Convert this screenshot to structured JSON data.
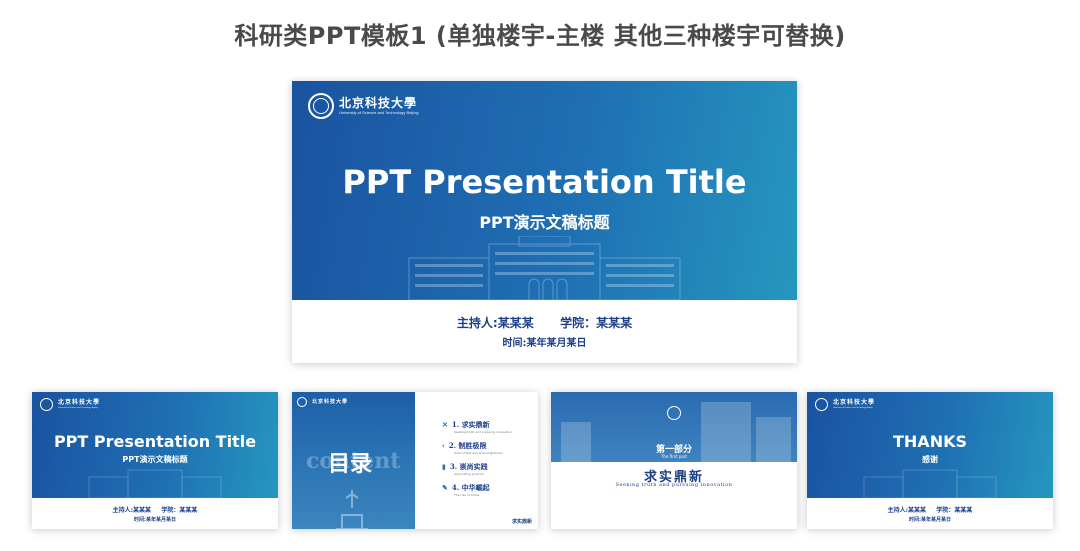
{
  "page": {
    "title": "科研类PPT模板1 (单独楼宇-主楼  其他三种楼宇可替换)"
  },
  "logo": {
    "name_cn": "北京科技大學",
    "name_en": "University of Science and Technology Beijing"
  },
  "main_slide": {
    "title_en": "PPT Presentation Title",
    "title_cn": "PPT演示文稿标题",
    "presenter": "主持人:某某某",
    "college": "学院：某某某",
    "time": "时间:某年某月某日"
  },
  "thumb1": {
    "title_en": "PPT Presentation Title",
    "title_cn": "PPT演示文稿标题",
    "presenter_line": "主持人:某某某     学院：某某某",
    "time": "时间:某年某月某日"
  },
  "thumb2": {
    "heading": "目录",
    "watermark": "content",
    "items": [
      {
        "label": "1. 求实鼎新",
        "sub": "Seeking truth and pursuing innovation"
      },
      {
        "label": "2. 制胜极限",
        "sub": "Goal of fast and slow brightness"
      },
      {
        "label": "3. 崇尚实践",
        "sub": "Advocating practice"
      },
      {
        "label": "4. 中华崛起",
        "sub": "The rise of China"
      }
    ],
    "footer": "求实鼎新"
  },
  "thumb3": {
    "part": "第一部分",
    "part_en": "The first part",
    "motto": "求实鼎新",
    "motto_en": "Seeking truth and pursuing innovation"
  },
  "thumb4": {
    "title": "THANKS",
    "subtitle": "感谢",
    "presenter_line": "主持人:某某某     学院：某某某",
    "time": "时间:某年某月某日"
  }
}
